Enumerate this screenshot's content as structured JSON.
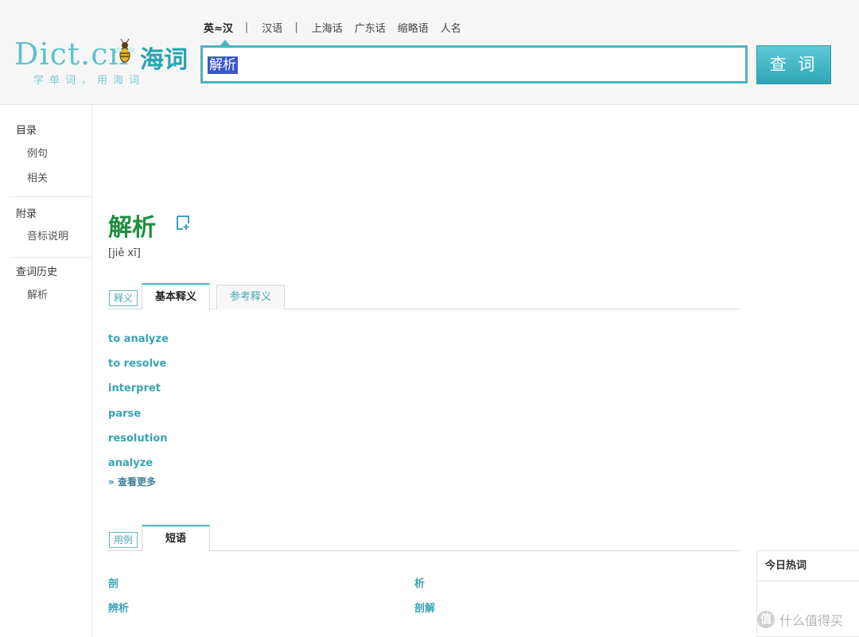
{
  "logo": {
    "text": "Dict.cn",
    "cn": "海词",
    "slogan": "学单词，用海词"
  },
  "nav": {
    "items": [
      "英≈汉",
      "汉语",
      "上海话",
      "广东话",
      "缩略语",
      "人名"
    ],
    "active": "英≈汉"
  },
  "search": {
    "value": "解析",
    "button_label": "查 词"
  },
  "sidebar": {
    "groups": [
      {
        "title": "目录",
        "items": [
          "例句",
          "相关"
        ]
      },
      {
        "title": "附录",
        "items": [
          "音标说明"
        ]
      },
      {
        "title": "查词历史",
        "items": [
          "解析"
        ]
      }
    ]
  },
  "entry": {
    "word": "解析",
    "pinyin": "[jiě xī]",
    "definition_tabs": {
      "label": "释义",
      "tabs": [
        "基本释义",
        "参考释义"
      ]
    },
    "definitions": [
      "to analyze",
      "to resolve",
      "interpret",
      "parse",
      "resolution",
      "analyze"
    ],
    "more_label": "查看更多",
    "usage_tabs": {
      "label": "用例",
      "tabs": [
        "短语"
      ]
    },
    "phrases": [
      "剖",
      "析",
      "辨析",
      "剖解"
    ]
  },
  "hot_words": {
    "title": "今日热词"
  },
  "watermark": {
    "icon": "值",
    "text": "什么值得买"
  },
  "colors": {
    "accent": "#4bb3c3",
    "word_green": "#1e8e3e",
    "link_teal": "#3aa3b4"
  },
  "icons": {
    "note": "add-note-icon",
    "more": "chevron-double-down-icon",
    "bee": "bee-mascot-icon"
  }
}
